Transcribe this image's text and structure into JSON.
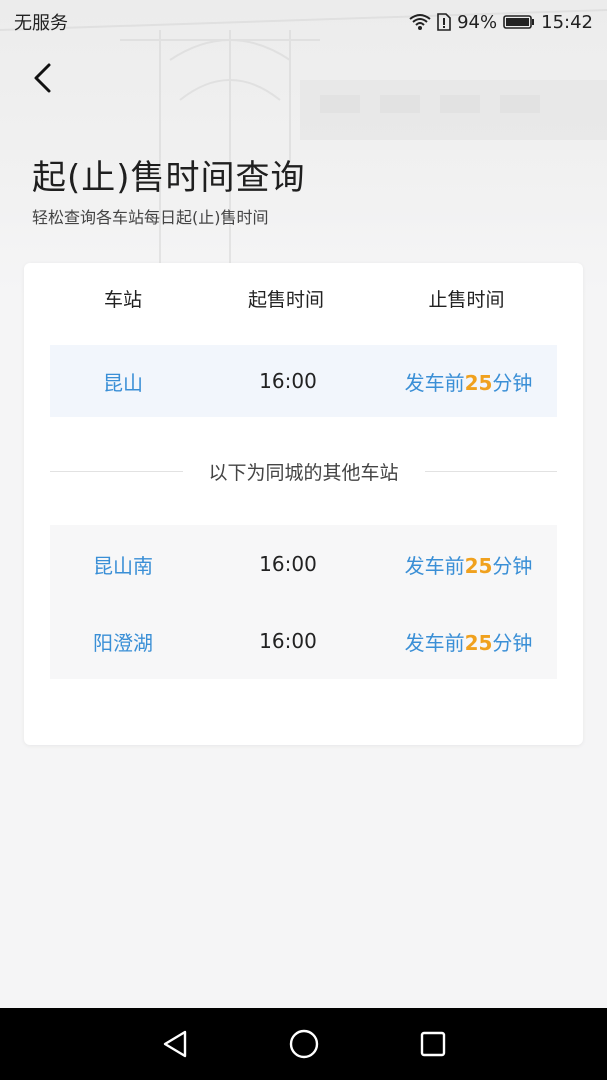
{
  "status_bar": {
    "carrier": "无服务",
    "battery": "94%",
    "time": "15:42"
  },
  "header": {
    "title": "起(止)售时间查询",
    "subtitle": "轻松查询各车站每日起(止)售时间"
  },
  "table": {
    "headers": [
      "车站",
      "起售时间",
      "止售时间"
    ],
    "main_station": {
      "name": "昆山",
      "start_time": "16:00",
      "stop_prefix": "发车前",
      "stop_minutes": "25",
      "stop_suffix": "分钟"
    },
    "divider_text": "以下为同城的其他车站",
    "other_stations": [
      {
        "name": "昆山南",
        "start_time": "16:00",
        "stop_prefix": "发车前",
        "stop_minutes": "25",
        "stop_suffix": "分钟"
      },
      {
        "name": "阳澄湖",
        "start_time": "16:00",
        "stop_prefix": "发车前",
        "stop_minutes": "25",
        "stop_suffix": "分钟"
      }
    ]
  },
  "colors": {
    "accent_blue": "#3a8fd6",
    "accent_orange": "#f0a11e"
  },
  "icons": {
    "back": "back-arrow-icon",
    "wifi": "wifi-icon",
    "alert": "sim-alert-icon",
    "battery": "battery-icon",
    "nav_back": "nav-back-icon",
    "nav_home": "nav-home-icon",
    "nav_recents": "nav-recents-icon"
  }
}
